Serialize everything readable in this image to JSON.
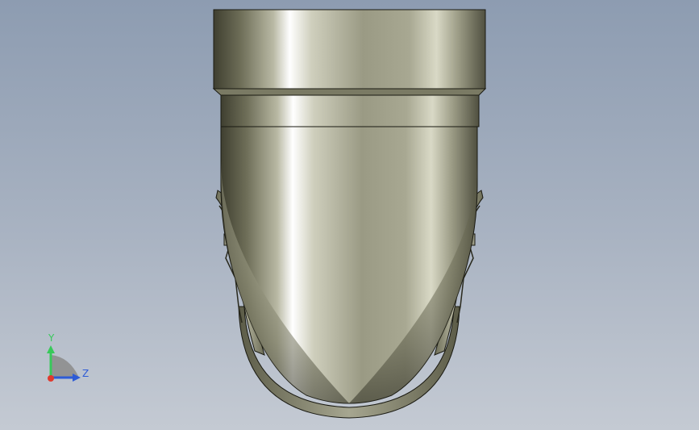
{
  "viewport": {
    "background_top": "#8d9cb1",
    "background_bottom": "#c4cad3"
  },
  "model": {
    "part": "pipe-elbow",
    "material_color": "#8c8c70"
  },
  "triad": {
    "y_label": "Y",
    "z_label": "Z",
    "y_color": "#38c95a",
    "z_color": "#2e5bd6",
    "x_color": "#e03a2e"
  }
}
